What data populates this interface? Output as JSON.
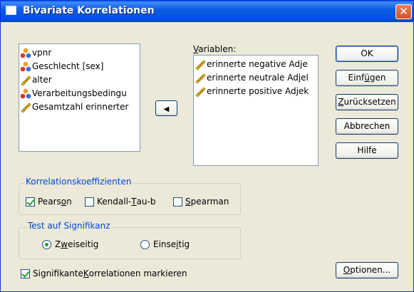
{
  "window": {
    "title": "Bivariate Korrelationen",
    "close_glyph": "✕"
  },
  "source_list": {
    "items": [
      {
        "label": "vpnr",
        "icon": "nominal-icon"
      },
      {
        "label": "Geschlecht [sex]",
        "icon": "nominal-icon"
      },
      {
        "label": "alter",
        "icon": "scale-icon"
      },
      {
        "label": "Verarbeitungsbedingu",
        "icon": "nominal-icon"
      },
      {
        "label": "Gesamtzahl erinnerter",
        "icon": "scale-icon"
      }
    ]
  },
  "transfer_button": {
    "glyph": "◀"
  },
  "variables": {
    "label_u": "V",
    "label_rest": "ariablen:",
    "items": [
      {
        "label": "erinnerte negative Adje",
        "icon": "scale-icon"
      },
      {
        "label": "erinnerte neutrale Adjel",
        "icon": "scale-icon"
      },
      {
        "label": "erinnerte positive Adjek",
        "icon": "scale-icon"
      }
    ]
  },
  "buttons": {
    "ok": "OK",
    "einfuegen_pre": "Einf",
    "einfuegen_u": "ü",
    "einfuegen_post": "gen",
    "zuruecksetzen_u": "Z",
    "zuruecksetzen_post": "urücksetzen",
    "abbrechen": "Abbrechen",
    "hilfe": "Hilfe",
    "optionen_u": "O",
    "optionen_post": "ptionen..."
  },
  "korrelation": {
    "title": "Korrelationskoeffizienten",
    "pearson_pre": "Pears",
    "pearson_u": "o",
    "pearson_post": "n",
    "pearson_checked": true,
    "kendall_pre": "Kendall-",
    "kendall_u": "T",
    "kendall_post": "au-b",
    "kendall_checked": false,
    "spearman_u": "S",
    "spearman_post": "pearman",
    "spearman_checked": false
  },
  "test": {
    "title": "Test auf Signifikanz",
    "zwei_pre": "Z",
    "zwei_u": "w",
    "zwei_post": "eiseitig",
    "zwei_selected": true,
    "ein_pre": "Einse",
    "ein_u": "i",
    "ein_post": "tig",
    "ein_selected": false
  },
  "markieren": {
    "pre": "Signifikante ",
    "u": "K",
    "post": "orrelationen markieren",
    "checked": true
  }
}
